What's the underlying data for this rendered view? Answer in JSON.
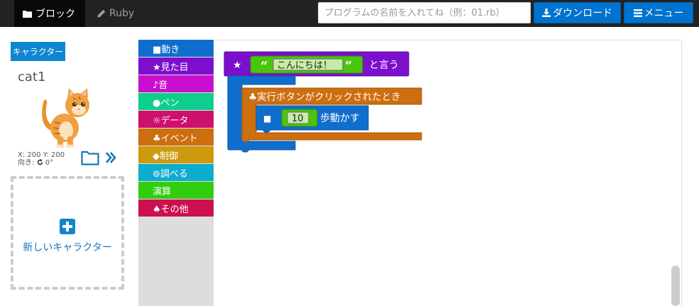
{
  "topbar": {
    "tab_block": "ブロック",
    "tab_ruby": "Ruby",
    "program_name_placeholder": "プログラムの名前を入れてね（例：01.rb）",
    "download_label": "ダウンロード",
    "menu_label": "メニュー"
  },
  "character_panel": {
    "header": "キャラクター",
    "name": "cat1",
    "position": "X: 200 Y: 200",
    "direction_label": "向き:",
    "direction_value": "0°",
    "new_character_label": "新しいキャラクター"
  },
  "toolbox": {
    "categories": [
      {
        "label": "■動き",
        "color": "#0f6ecd"
      },
      {
        "label": "★見た目",
        "color": "#7b0fcd"
      },
      {
        "label": "♪音",
        "color": "#c90fcd"
      },
      {
        "label": "●ペン",
        "color": "#0fcd8c"
      },
      {
        "label": "☼データ",
        "color": "#cd0f6e"
      },
      {
        "label": "♣イベント",
        "color": "#cd6e0f"
      },
      {
        "label": "◆制御",
        "color": "#cd990f"
      },
      {
        "label": "⊚調べる",
        "color": "#0fadcd"
      },
      {
        "label": "演算",
        "color": "#33cd0f"
      },
      {
        "label": "♠その他",
        "color": "#cd0f50"
      }
    ]
  },
  "blocks": {
    "say": {
      "star": "★",
      "open_quote": "“",
      "text": "こんにちは！",
      "close_quote": "”",
      "suffix": "と言う"
    },
    "event": {
      "label": "♣実行ボタンがクリックされたとき"
    },
    "move": {
      "square": "■",
      "steps": "10",
      "suffix": "歩動かす"
    }
  },
  "colors": {
    "accent": "#0073cf",
    "motion": "#0f6ecd",
    "looks": "#7b0fcd",
    "events": "#cd6e0f",
    "operators": "#33cd0f"
  }
}
